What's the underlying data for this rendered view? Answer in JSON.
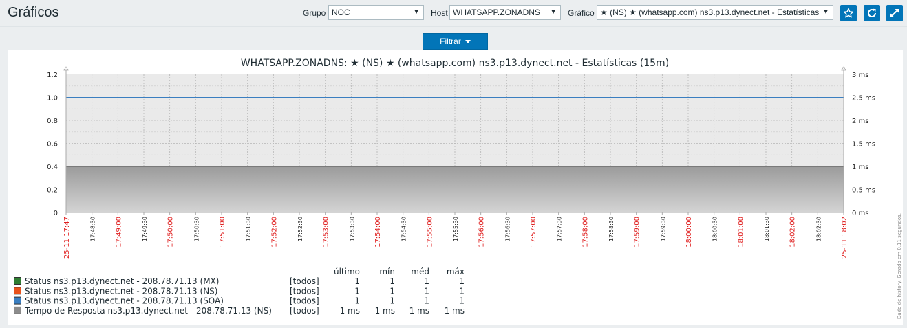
{
  "page_title": "Gráficos",
  "filters": {
    "group_label": "Grupo",
    "group_value": "NOC",
    "host_label": "Host",
    "host_value": "WHATSAPP.ZONADNS",
    "graph_label": "Gráfico",
    "graph_value": "★ (NS) ★ (whatsapp.com) ns3.p13.dynect.net - Estatísticas"
  },
  "icons": {
    "favorite": "star-icon",
    "refresh": "refresh-icon",
    "fullscreen": "fullscreen-icon"
  },
  "filter_button": "Filtrar",
  "colors": {
    "accent": "#0275b8",
    "mx": "#2f7d32",
    "ns": "#e8521b",
    "soa": "#3a7ec0",
    "resp": "#8c8c8c",
    "red_label": "#e02020"
  },
  "graph": {
    "title": "WHATSAPP.ZONADNS: ★ (NS) ★ (whatsapp.com) ns3.p13.dynect.net - Estatísticas (15m)",
    "footer": "Dado de history. Gerado em 0.11 segundos."
  },
  "chart_data": {
    "type": "line",
    "title": "WHATSAPP.ZONADNS: ★ (NS) ★ (whatsapp.com) ns3.p13.dynect.net - Estatísticas (15m)",
    "x_labels": [
      {
        "t": "25-11 17:47",
        "major": true
      },
      {
        "t": "17:48:30",
        "major": false
      },
      {
        "t": "17:49:00",
        "major": true
      },
      {
        "t": "17:49:30",
        "major": false
      },
      {
        "t": "17:50:00",
        "major": true
      },
      {
        "t": "17:50:30",
        "major": false
      },
      {
        "t": "17:51:00",
        "major": true
      },
      {
        "t": "17:51:30",
        "major": false
      },
      {
        "t": "17:52:00",
        "major": true
      },
      {
        "t": "17:52:30",
        "major": false
      },
      {
        "t": "17:53:00",
        "major": true
      },
      {
        "t": "17:53:30",
        "major": false
      },
      {
        "t": "17:54:00",
        "major": true
      },
      {
        "t": "17:54:30",
        "major": false
      },
      {
        "t": "17:55:00",
        "major": true
      },
      {
        "t": "17:55:30",
        "major": false
      },
      {
        "t": "17:56:00",
        "major": true
      },
      {
        "t": "17:56:30",
        "major": false
      },
      {
        "t": "17:57:00",
        "major": true
      },
      {
        "t": "17:57:30",
        "major": false
      },
      {
        "t": "17:58:00",
        "major": true
      },
      {
        "t": "17:58:30",
        "major": false
      },
      {
        "t": "17:59:00",
        "major": true
      },
      {
        "t": "17:59:30",
        "major": false
      },
      {
        "t": "18:00:00",
        "major": true
      },
      {
        "t": "18:00:30",
        "major": false
      },
      {
        "t": "18:01:00",
        "major": true
      },
      {
        "t": "18:01:30",
        "major": false
      },
      {
        "t": "18:02:00",
        "major": true
      },
      {
        "t": "18:02:30",
        "major": false
      },
      {
        "t": "25-11 18:02",
        "major": true
      }
    ],
    "y_left_ticks": [
      "0",
      "0.2",
      "0.4",
      "0.6",
      "0.8",
      "1.0",
      "1.2"
    ],
    "y_left_range": [
      0,
      1.2
    ],
    "y_right_ticks": [
      "0 ms",
      "0.5 ms",
      "1 ms",
      "1.5 ms",
      "2 ms",
      "2.5 ms",
      "3 ms"
    ],
    "y_right_range": [
      0,
      3
    ],
    "grid": true,
    "series": [
      {
        "name": "Status ns3.p13.dynect.net - 208.78.71.13 (MX)",
        "axis": "left",
        "value": 1,
        "color": "#2f7d32"
      },
      {
        "name": "Status ns3.p13.dynect.net - 208.78.71.13 (NS)",
        "axis": "left",
        "value": 1,
        "color": "#e8521b"
      },
      {
        "name": "Status ns3.p13.dynect.net - 208.78.71.13 (SOA)",
        "axis": "left",
        "value": 1,
        "color": "#3a7ec0"
      },
      {
        "name": "Tempo de Resposta ns3.p13.dynect.net - 208.78.71.13 (NS)",
        "axis": "right",
        "value": 1,
        "color": "#8c8c8c",
        "filled": true
      }
    ]
  },
  "legend": {
    "headers": [
      "último",
      "mín",
      "méd",
      "máx"
    ],
    "rows": [
      {
        "name": "Status ns3.p13.dynect.net - 208.78.71.13 (MX)",
        "func": "[todos]",
        "last": "1",
        "min": "1",
        "avg": "1",
        "max": "1",
        "color": "#2f7d32"
      },
      {
        "name": "Status ns3.p13.dynect.net - 208.78.71.13 (NS)",
        "func": "[todos]",
        "last": "1",
        "min": "1",
        "avg": "1",
        "max": "1",
        "color": "#e8521b"
      },
      {
        "name": "Status ns3.p13.dynect.net - 208.78.71.13 (SOA)",
        "func": "[todos]",
        "last": "1",
        "min": "1",
        "avg": "1",
        "max": "1",
        "color": "#3a7ec0"
      },
      {
        "name": "Tempo de Resposta ns3.p13.dynect.net - 208.78.71.13 (NS)",
        "func": "[todos]",
        "last": "1 ms",
        "min": "1 ms",
        "avg": "1 ms",
        "max": "1 ms",
        "color": "#8c8c8c"
      }
    ]
  }
}
